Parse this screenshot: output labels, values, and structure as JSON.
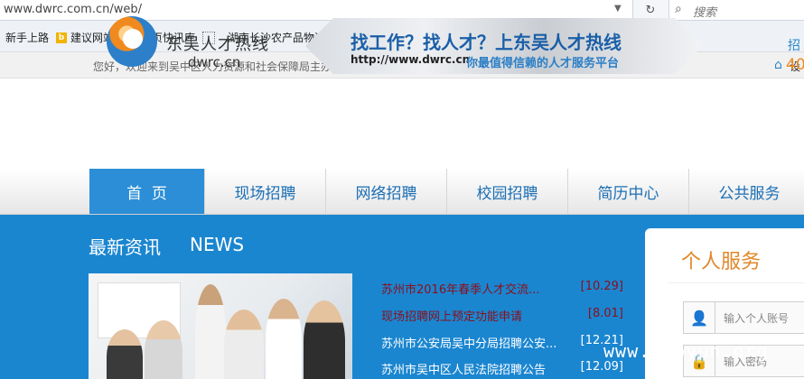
{
  "browser": {
    "url": "www.dwrc.com.cn/web/",
    "search_placeholder": "搜索",
    "bookmarks": [
      "新手上路",
      "建议网站",
      "网页快讯库",
      "湖南长沙农产品物流..."
    ]
  },
  "site": {
    "welcome": "您好，欢迎来到吴中区人力资源和社会保障局主办公共人才服务网站！",
    "home_setting": "设",
    "logo_name": "东吴人才热线",
    "logo_domain": "dwrc.cn",
    "banner_title": "找工作？找人才？上东吴人才热线",
    "banner_url": "http://www.dwrc.cn",
    "banner_sub": "你最值得信赖的人才服务平台",
    "header_right_a": "招",
    "header_right_b": "40"
  },
  "nav": {
    "items": [
      "首  页",
      "现场招聘",
      "网络招聘",
      "校园招聘",
      "简历中心",
      "公共服务"
    ],
    "active_index": 0
  },
  "news": {
    "title": "最新资讯",
    "title_en": "NEWS",
    "items": [
      {
        "title": "苏州市2016年春季人才交流...",
        "date": "[10.29]",
        "style": "red"
      },
      {
        "title": "现场招聘网上预定功能申请",
        "date": "[8.01]",
        "style": "red"
      },
      {
        "title": "苏州市公安局吴中分局招聘公安...",
        "date": "[12.21]",
        "style": "white"
      },
      {
        "title": "苏州市吴中区人民法院招聘公告",
        "date": "[12.09]",
        "style": "white"
      }
    ]
  },
  "service": {
    "title": "个人服务",
    "account_placeholder": "输入个人账号",
    "password_placeholder": "输入密码"
  },
  "watermark": "www.wooyun.org",
  "colors": {
    "nav_active": "#2b8ed6",
    "main_blue": "#1b86d0",
    "service_orange": "#e0882a",
    "news_red": "#8b0f1a"
  }
}
